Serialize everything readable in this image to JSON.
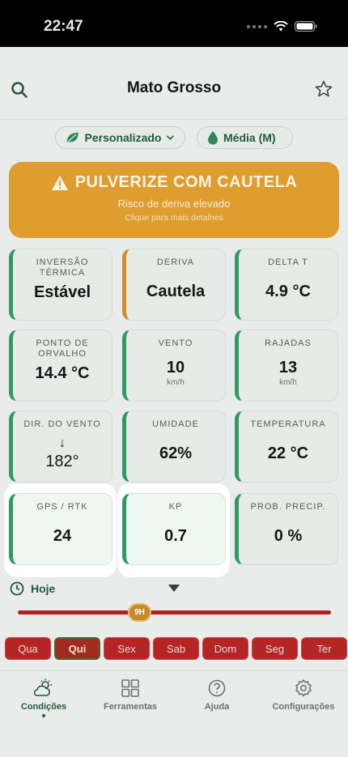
{
  "status": {
    "time": "22:47"
  },
  "header": {
    "title": "Mato Grosso"
  },
  "pills": {
    "profile": "Personalizado",
    "size": "Média (M)"
  },
  "alert": {
    "title": "PULVERIZE COM CAUTELA",
    "subtitle": "Risco de deriva elevado",
    "hint": "Clique para mais detalhes",
    "color": "#df9c2f"
  },
  "cards": {
    "inversao": {
      "label": "INVERSÃO TÉRMICA",
      "value": "Estável"
    },
    "deriva": {
      "label": "DERIVA",
      "value": "Cautela"
    },
    "delta_t": {
      "label": "DELTA T",
      "value": "4.9 °C"
    },
    "orvalho": {
      "label": "PONTO DE ORVALHO",
      "value": "14.4 °C"
    },
    "vento": {
      "label": "VENTO",
      "value": "10",
      "unit": "km/h"
    },
    "rajadas": {
      "label": "RAJADAS",
      "value": "13",
      "unit": "km/h"
    },
    "dir_vento": {
      "label": "DIR. DO VENTO",
      "arrow": "↓",
      "value": "182°"
    },
    "umidade": {
      "label": "UMIDADE",
      "value": "62%"
    },
    "temperatura": {
      "label": "TEMPERATURA",
      "value": "22 °C"
    },
    "gps": {
      "label": "GPS / RTK",
      "value": "24"
    },
    "kp": {
      "label": "KP",
      "value": "0.7"
    },
    "precip": {
      "label": "PROB. PRECIP.",
      "value": "0 %"
    }
  },
  "timeline": {
    "day_label": "Hoje",
    "hour": "9H",
    "days": [
      "Qua",
      "Qui",
      "Sex",
      "Sab",
      "Dom",
      "Seg",
      "Ter"
    ],
    "selected_day": "Qui"
  },
  "tabbar": {
    "items": [
      {
        "label": "Condições",
        "icon": "weather-icon"
      },
      {
        "label": "Ferramentas",
        "icon": "grid-icon"
      },
      {
        "label": "Ajuda",
        "icon": "help-icon"
      },
      {
        "label": "Configurações",
        "icon": "gear-icon"
      }
    ],
    "active": "Condições"
  },
  "colors": {
    "accent_green": "#2f9a64",
    "warning_orange": "#df9c2f",
    "day_red": "#b42526"
  }
}
